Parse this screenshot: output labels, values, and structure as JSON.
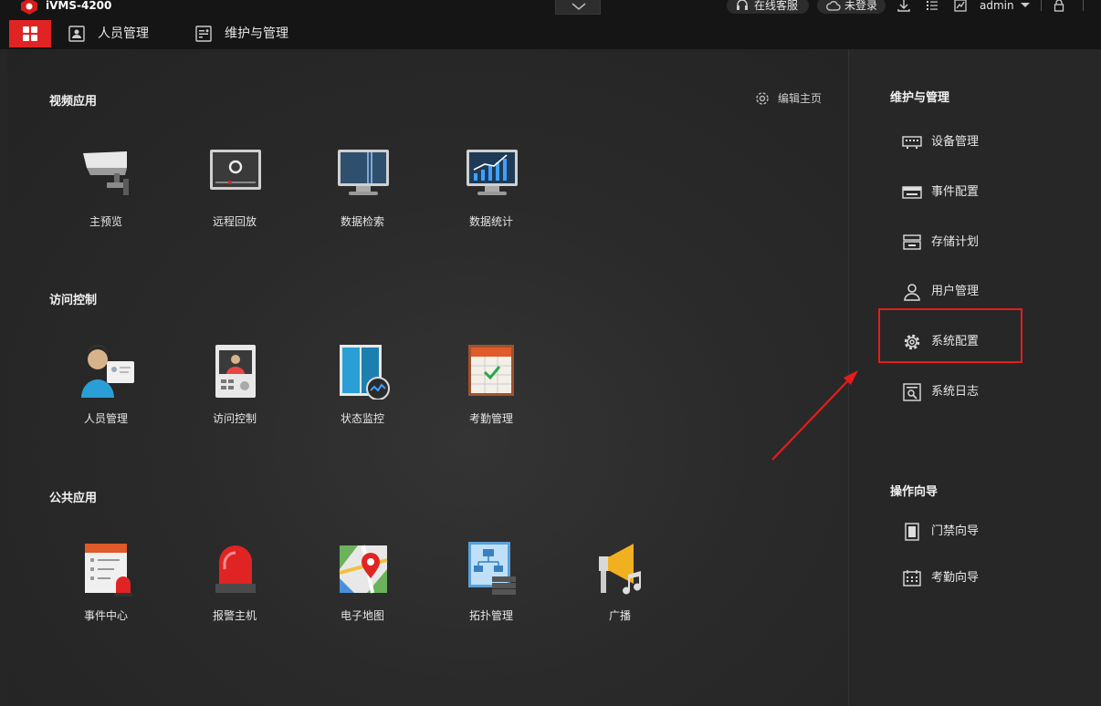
{
  "titlebar": {
    "app_title": "iVMS-4200",
    "online_service": "在线客服",
    "not_logged_in": "未登录",
    "user": "admin",
    "icons": [
      "download-icon",
      "list-icon",
      "chart-icon",
      "lock-icon"
    ]
  },
  "menubar": {
    "items": [
      {
        "label": "人员管理",
        "icon": "person-card-icon"
      },
      {
        "label": "维护与管理",
        "icon": "maintenance-icon"
      }
    ]
  },
  "main": {
    "edit_home": "编辑主页",
    "sections": [
      {
        "title": "视频应用",
        "apps": [
          {
            "label": "主预览",
            "icon": "camera-icon"
          },
          {
            "label": "远程回放",
            "icon": "playback-icon"
          },
          {
            "label": "数据检索",
            "icon": "monitor-search-icon"
          },
          {
            "label": "数据统计",
            "icon": "monitor-chart-icon"
          }
        ]
      },
      {
        "title": "访问控制",
        "apps": [
          {
            "label": "人员管理",
            "icon": "person-id-icon"
          },
          {
            "label": "访问控制",
            "icon": "intercom-icon"
          },
          {
            "label": "状态监控",
            "icon": "door-monitor-icon"
          },
          {
            "label": "考勤管理",
            "icon": "calendar-check-icon"
          }
        ]
      },
      {
        "title": "公共应用",
        "apps": [
          {
            "label": "事件中心",
            "icon": "event-center-icon"
          },
          {
            "label": "报警主机",
            "icon": "alarm-light-icon"
          },
          {
            "label": "电子地图",
            "icon": "map-pin-icon"
          },
          {
            "label": "拓扑管理",
            "icon": "topology-icon"
          },
          {
            "label": "广播",
            "icon": "broadcast-icon"
          }
        ]
      }
    ]
  },
  "side": {
    "maintenance_title": "维护与管理",
    "maintenance_items": [
      {
        "label": "设备管理",
        "icon": "device-icon"
      },
      {
        "label": "事件配置",
        "icon": "event-config-icon"
      },
      {
        "label": "存储计划",
        "icon": "storage-icon"
      },
      {
        "label": "用户管理",
        "icon": "user-icon"
      },
      {
        "label": "系统配置",
        "icon": "gear-icon"
      },
      {
        "label": "系统日志",
        "icon": "log-icon"
      }
    ],
    "guide_title": "操作向导",
    "guide_items": [
      {
        "label": "门禁向导",
        "icon": "door-icon"
      },
      {
        "label": "考勤向导",
        "icon": "calendar-icon"
      }
    ]
  },
  "colors": {
    "accent": "#e02424",
    "highlight_box": "#e61c1c",
    "background": "#262626",
    "bar": "#151515"
  }
}
